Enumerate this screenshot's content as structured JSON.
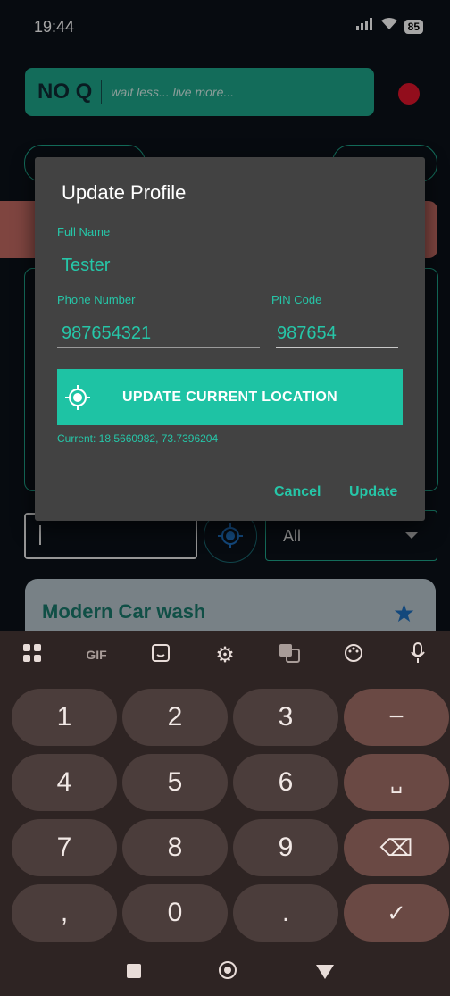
{
  "status": {
    "time": "19:44",
    "battery": "85"
  },
  "app": {
    "brand": "NO Q",
    "tagline": "wait less... live more..."
  },
  "filter": {
    "selected": "All"
  },
  "card": {
    "title": "Modern Car wash"
  },
  "dialog": {
    "title": "Update Profile",
    "full_name_label": "Full Name",
    "full_name_value": "Tester",
    "phone_label": "Phone Number",
    "phone_value": "987654321",
    "pin_label": "PIN Code",
    "pin_value": "987654",
    "location_button": "UPDATE CURRENT LOCATION",
    "current_location": "Current: 18.5660982, 73.7396204",
    "cancel": "Cancel",
    "update": "Update"
  },
  "keyboard": {
    "tools": [
      "apps-icon",
      "GIF",
      "sticker-icon",
      "gear-icon",
      "translate-icon",
      "palette-icon",
      "mic-icon"
    ],
    "gif_label": "GIF",
    "keys": {
      "k1": "1",
      "k2": "2",
      "k3": "3",
      "minus": "−",
      "k4": "4",
      "k5": "5",
      "k6": "6",
      "space": "␣",
      "k7": "7",
      "k8": "8",
      "k9": "9",
      "backspace": "⌫",
      "comma": ",",
      "k0": "0",
      "period": ".",
      "enter": "✓"
    }
  },
  "colors": {
    "accent": "#1ec3a4",
    "dialog_bg": "#424242",
    "keyboard_bg": "#2e2423"
  }
}
